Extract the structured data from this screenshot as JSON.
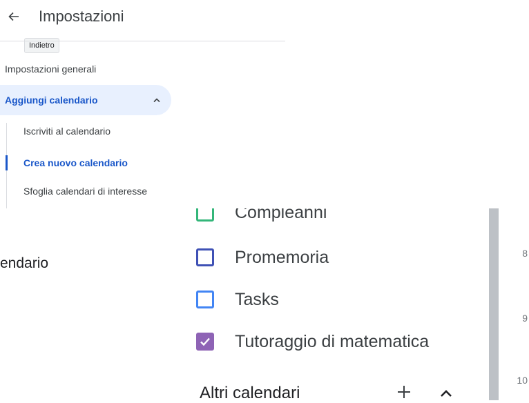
{
  "settings": {
    "title": "Impostazioni",
    "back_tooltip": "Indietro",
    "nav": {
      "general": "Impostazioni generali",
      "add_calendar": "Aggiungi calendario",
      "sub_items": [
        "Iscriviti al calendario",
        "Crea nuovo calendario",
        "Sfoglia calendari di interesse"
      ]
    }
  },
  "fragment_text": "endario",
  "calendars": {
    "items": [
      {
        "label": "Compleanni",
        "color": "#33b679",
        "checked": false
      },
      {
        "label": "Promemoria",
        "color": "#3f51b5",
        "checked": false
      },
      {
        "label": "Tasks",
        "color": "#4285f4",
        "checked": false
      },
      {
        "label": "Tutoraggio di matematica",
        "color": "#8e63b5",
        "checked": true
      }
    ],
    "other_header": "Altri calendari"
  },
  "hours": [
    "8",
    "9",
    "10"
  ],
  "icons": {
    "back": "arrow-left-icon",
    "expand": "chevron-up-icon",
    "add": "plus-icon",
    "collapse": "chevron-up-icon",
    "check": "check-icon"
  },
  "colors": {
    "accent": "#1a57c9",
    "selected_bg": "#e8f0fe"
  }
}
